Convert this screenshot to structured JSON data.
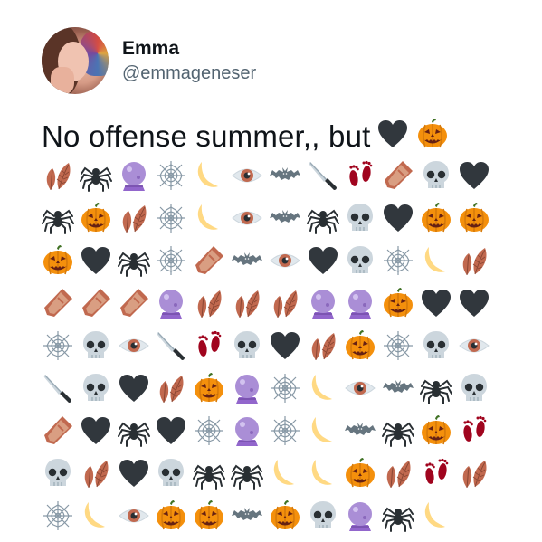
{
  "user": {
    "display_name": "Emma",
    "handle": "@emmageneser"
  },
  "tweet": {
    "text": "No offense summer,, but",
    "text_emojis": [
      "black-heart",
      "jack-o-lantern"
    ],
    "emoji_rows": [
      [
        "fallen-leaf",
        "spider",
        "crystal-ball",
        "spider-web",
        "crescent-moon",
        "eye",
        "bat",
        "kitchen-knife",
        "footprints",
        "coffin",
        "skull",
        "black-heart"
      ],
      [
        "spider",
        "jack-o-lantern",
        "fallen-leaf",
        "spider-web",
        "crescent-moon",
        "eye",
        "bat",
        "spider",
        "skull",
        "black-heart",
        "jack-o-lantern",
        "jack-o-lantern"
      ],
      [
        "jack-o-lantern",
        "black-heart",
        "spider",
        "spider-web",
        "coffin",
        "bat",
        "eye",
        "black-heart",
        "skull",
        "spider-web",
        "crescent-moon",
        "fallen-leaf"
      ],
      [
        "coffin",
        "coffin",
        "coffin",
        "crystal-ball",
        "fallen-leaf",
        "fallen-leaf",
        "fallen-leaf",
        "crystal-ball",
        "crystal-ball",
        "jack-o-lantern",
        "black-heart",
        "black-heart"
      ],
      [
        "spider-web",
        "skull",
        "eye",
        "kitchen-knife",
        "footprints",
        "skull",
        "black-heart",
        "fallen-leaf",
        "jack-o-lantern",
        "spider-web",
        "skull",
        "eye"
      ],
      [
        "kitchen-knife",
        "skull",
        "black-heart",
        "fallen-leaf",
        "jack-o-lantern",
        "crystal-ball",
        "spider-web",
        "crescent-moon",
        "eye",
        "bat",
        "spider",
        "skull"
      ],
      [
        "coffin",
        "black-heart",
        "spider",
        "black-heart",
        "spider-web",
        "crystal-ball",
        "spider-web",
        "crescent-moon",
        "bat",
        "spider",
        "jack-o-lantern",
        "footprints"
      ],
      [
        "skull",
        "fallen-leaf",
        "black-heart",
        "skull",
        "spider",
        "spider",
        "crescent-moon",
        "crescent-moon",
        "jack-o-lantern",
        "fallen-leaf",
        "footprints",
        "fallen-leaf"
      ],
      [
        "spider-web",
        "crescent-moon",
        "eye",
        "jack-o-lantern",
        "jack-o-lantern",
        "bat",
        "jack-o-lantern",
        "skull",
        "crystal-ball",
        "spider",
        "crescent-moon"
      ]
    ]
  },
  "colors": {
    "text": "#0f1419",
    "secondary_text": "#536471",
    "background": "#ffffff"
  }
}
